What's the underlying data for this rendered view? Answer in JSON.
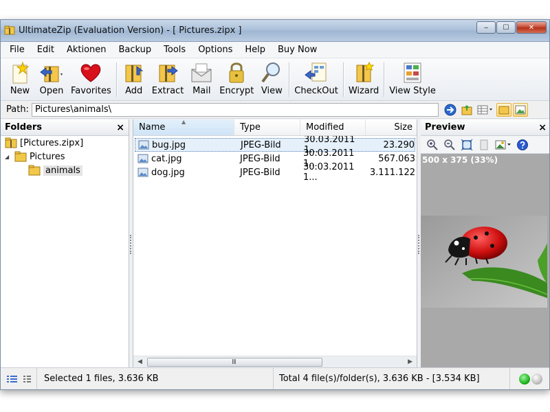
{
  "window": {
    "title": "UltimateZip (Evaluation Version) - [ Pictures.zipx ]",
    "buttons": {
      "minimize": "‒",
      "maximize": "☐",
      "close": "✕"
    }
  },
  "menu": [
    "File",
    "Edit",
    "Aktionen",
    "Backup",
    "Tools",
    "Options",
    "Help",
    "Buy Now"
  ],
  "toolbar": {
    "new": "New",
    "open": "Open",
    "favorites": "Favorites",
    "add": "Add",
    "extract": "Extract",
    "mail": "Mail",
    "encrypt": "Encrypt",
    "view": "View",
    "checkout": "CheckOut",
    "wizard": "Wizard",
    "view_style": "View Style"
  },
  "path": {
    "label": "Path:",
    "value": "Pictures\\animals\\"
  },
  "folders": {
    "title": "Folders",
    "close": "×",
    "tree": [
      {
        "label": "[Pictures.zipx]"
      },
      {
        "label": "Pictures",
        "expand": "◢"
      },
      {
        "label": "animals"
      }
    ]
  },
  "filelist": {
    "columns": [
      "Name",
      "Type",
      "Modified",
      "Size"
    ],
    "sort_arrow": "▲",
    "rows": [
      {
        "name": "bug.jpg",
        "type": "JPEG-Bild",
        "modified": "30.03.2011  1...",
        "size": "23.290",
        "selected": true
      },
      {
        "name": "cat.jpg",
        "type": "JPEG-Bild",
        "modified": "30.03.2011  1...",
        "size": "567.063",
        "selected": false
      },
      {
        "name": "dog.jpg",
        "type": "JPEG-Bild",
        "modified": "30.03.2011  1...",
        "size": "3.111.122",
        "selected": false
      }
    ],
    "scroll": {
      "left": "◀",
      "right": "▶",
      "grip": "III"
    }
  },
  "preview": {
    "title": "Preview",
    "close": "×",
    "info": "500 x 375 (33%)"
  },
  "status": {
    "selected": "Selected 1 files, 3.636 KB",
    "total": "Total 4 file(s)/folder(s), 3.636 KB - [3.534 KB]"
  },
  "colors": {
    "selection": "#e5f0fb",
    "preview_bg": "#a9a9a9",
    "status_green": "#1fb51f",
    "status_gray": "#c0c0c0"
  }
}
